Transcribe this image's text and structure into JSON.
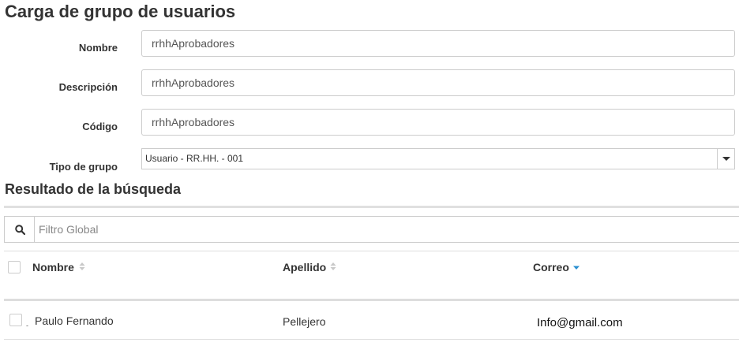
{
  "page": {
    "title": "Carga de grupo de usuarios"
  },
  "form": {
    "nombre": {
      "label": "Nombre",
      "value": "rrhhAprobadores"
    },
    "descripcion": {
      "label": "Descripción",
      "value": "rrhhAprobadores"
    },
    "codigo": {
      "label": "Código",
      "value": "rrhhAprobadores"
    },
    "tipo_grupo": {
      "label": "Tipo de grupo",
      "selected": "Usuario - RR.HH. - 001"
    }
  },
  "results": {
    "title": "Resultado de la búsqueda",
    "filter": {
      "placeholder": "Filtro Global",
      "value": "",
      "icon": "search-icon"
    },
    "columns": [
      {
        "label": "Nombre",
        "sort": "none"
      },
      {
        "label": "Apellido",
        "sort": "none"
      },
      {
        "label": "Correo",
        "sort": "descending"
      }
    ],
    "rows": [
      {
        "nombre": "Paulo Fernando",
        "apellido": "Pellejero",
        "correo": "Info@gmail.com",
        "selected": false
      }
    ]
  },
  "colors": {
    "text": "#333333",
    "border": "#cccccc",
    "sort_active": "#2a8fd0",
    "sort_inactive": "#c8c8c8"
  }
}
